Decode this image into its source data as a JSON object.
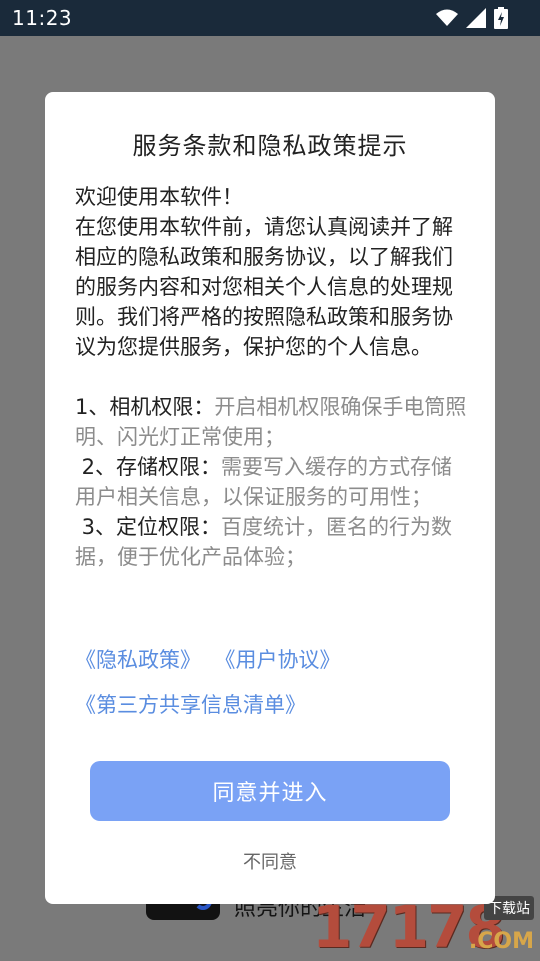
{
  "status_bar": {
    "time": "11:23",
    "icons": [
      "wifi-icon",
      "signal-icon",
      "battery-charging-icon"
    ]
  },
  "background": {
    "partial_text": "照亮你的生活",
    "watermark": {
      "digits": "17178",
      "tag": "下载站",
      "suffix": ".COM"
    }
  },
  "dialog": {
    "title": "服务条款和隐私政策提示",
    "intro_lines": [
      "欢迎使用本软件！",
      "在您使用本软件前，请您认真阅读并了解相应的隐私政策和服务协议，以了解我们的服务内容和对您相关个人信息的处理规则。我们将严格的按照隐私政策和服务协议为您提供服务，保护您的个人信息。"
    ],
    "permissions": [
      {
        "label": "1、相机权限：",
        "desc": "开启相机权限确保手电筒照明、闪光灯正常使用；"
      },
      {
        "label": " 2、存储权限：",
        "desc": "需要写入缓存的方式存储用户相关信息，以保证服务的可用性；"
      },
      {
        "label": " 3、定位权限：",
        "desc": "百度统计，匿名的行为数据，便于优化产品体验；"
      }
    ],
    "links": {
      "privacy_policy": "《隐私政策》",
      "user_agreement": "《用户协议》",
      "third_party_list": "《第三方共享信息清单》"
    },
    "agree_label": "同意并进入",
    "disagree_label": "不同意"
  },
  "colors": {
    "accent_button": "#7aa2f5",
    "link": "#5a8de0",
    "muted_text": "#8c8c8c",
    "status_bar": "#1a2a3a",
    "overlay": "#7a7a7a"
  }
}
